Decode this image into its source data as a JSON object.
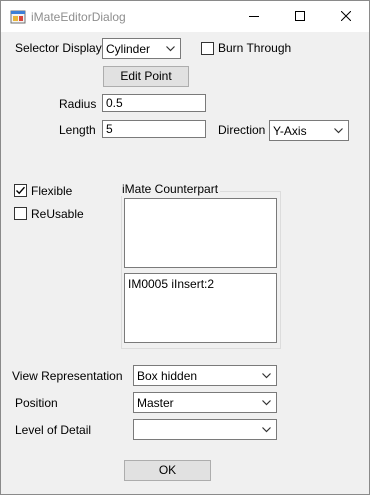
{
  "window": {
    "title": "iMateEditorDialog"
  },
  "selector": {
    "label": "Selector Display",
    "value": "Cylinder",
    "burn_through_label": "Burn Through",
    "burn_through_checked": false,
    "edit_point_label": "Edit Point"
  },
  "radius": {
    "label": "Radius",
    "value": "0.5"
  },
  "length": {
    "label": "Length",
    "value": "5"
  },
  "direction": {
    "label": "Direction",
    "value": "Y-Axis"
  },
  "flexible": {
    "label": "Flexible",
    "checked": true
  },
  "reusable": {
    "label": "ReUsable",
    "checked": false
  },
  "counterpart": {
    "title": "iMate Counterpart",
    "top_list": [],
    "bottom_list": [
      "IM0005 iInsert:2"
    ]
  },
  "view_representation": {
    "label": "View Representation",
    "value": "Box hidden"
  },
  "position": {
    "label": "Position",
    "value": "Master"
  },
  "level_of_detail": {
    "label": "Level of Detail",
    "value": ""
  },
  "ok_label": "OK",
  "icons": {
    "app": "app-icon",
    "minimize": "minimize-icon",
    "maximize": "maximize-icon",
    "close": "close-icon",
    "dropdown": "chevron-down-icon",
    "check": "check-icon"
  }
}
